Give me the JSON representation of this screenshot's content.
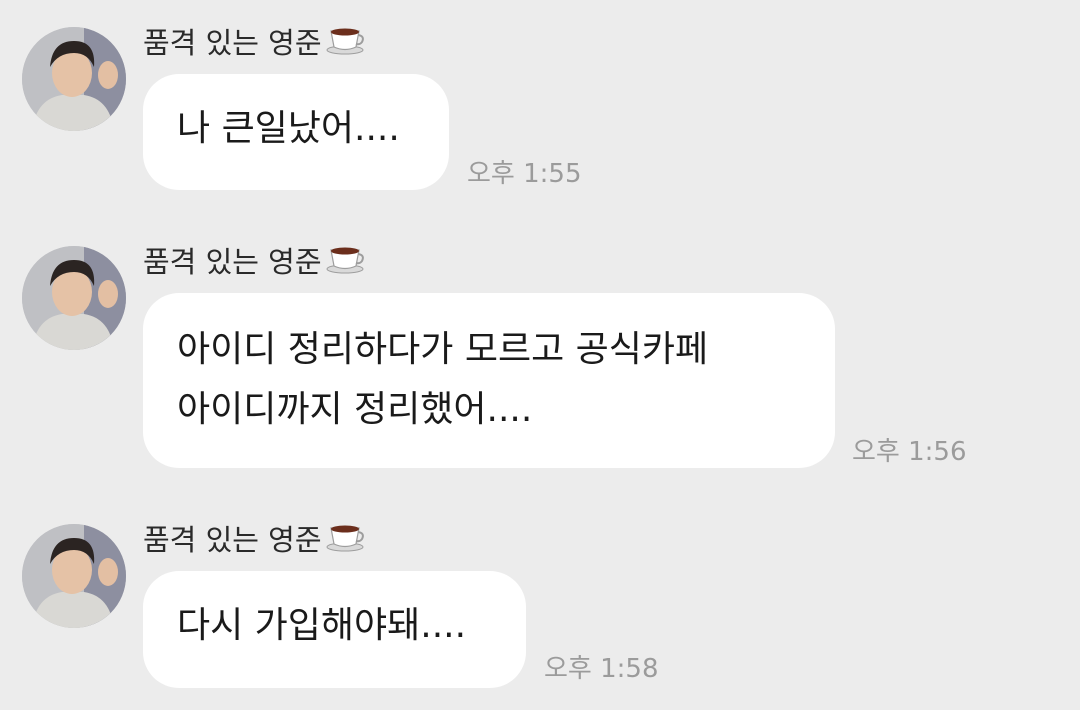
{
  "chat": {
    "messages": [
      {
        "sender": "품격 있는 영준",
        "sender_emoji": "coffee-cup-icon",
        "text": "나 큰일났어....",
        "time": "오후 1:55"
      },
      {
        "sender": "품격 있는 영준",
        "sender_emoji": "coffee-cup-icon",
        "lines": [
          "아이디 정리하다가 모르고 공식카페",
          "아이디까지 정리했어...."
        ],
        "time": "오후 1:56"
      },
      {
        "sender": "품격 있는 영준",
        "sender_emoji": "coffee-cup-icon",
        "text": "다시 가입해야돼....",
        "time": "오후 1:58"
      }
    ]
  },
  "colors": {
    "background": "#ececec",
    "bubble": "#ffffff",
    "timestamp": "#9b9b9b"
  }
}
